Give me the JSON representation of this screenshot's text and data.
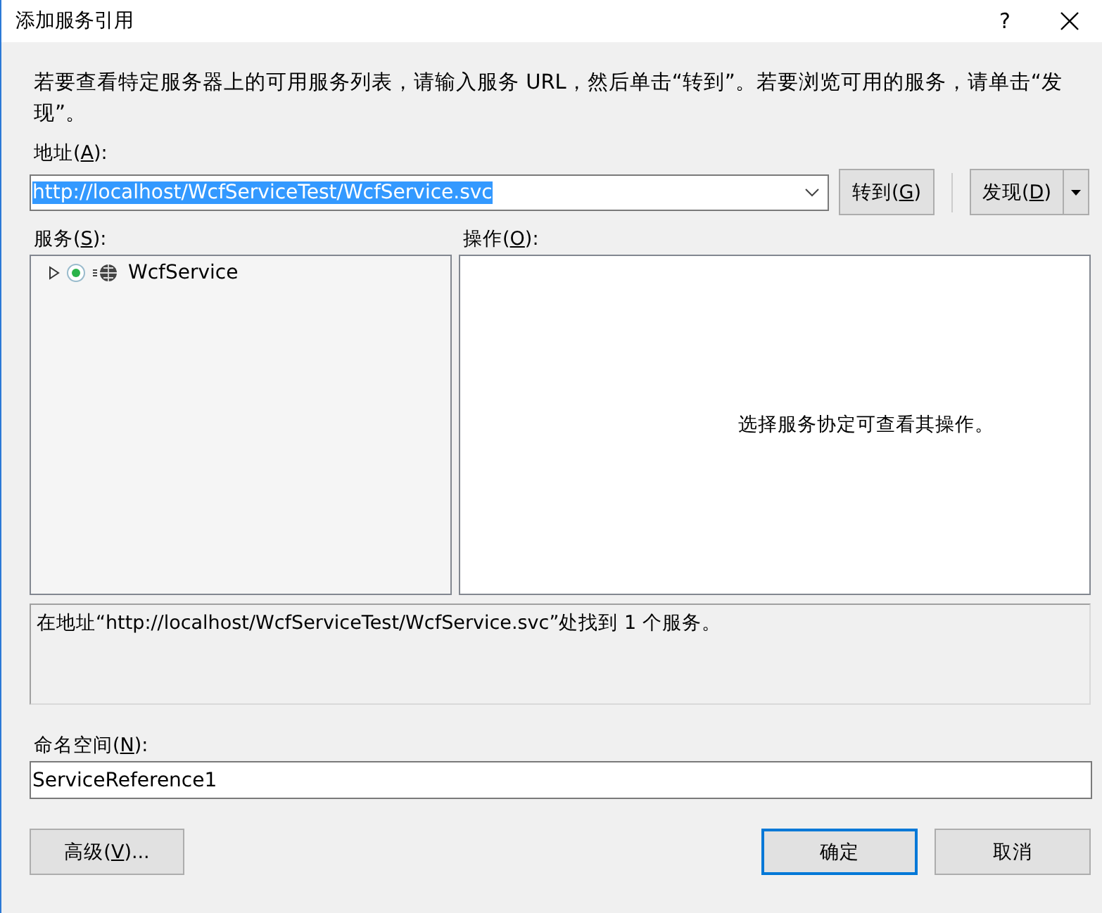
{
  "window": {
    "title": "添加服务引用",
    "help": "?"
  },
  "intro": "若要查看特定服务器上的可用服务列表，请输入服务 URL，然后单击“转到”。若要浏览可用的服务，请单击“发现”。",
  "address": {
    "label": {
      "prefix": "地址(",
      "key": "A",
      "suffix": "):"
    },
    "value": "http://localhost/WcfServiceTest/WcfService.svc",
    "highlighted": true
  },
  "go_button": {
    "prefix": "转到(",
    "key": "G",
    "suffix": ")"
  },
  "discover_button": {
    "prefix": "发现(",
    "key": "D",
    "suffix": ")"
  },
  "services": {
    "label": {
      "prefix": "服务(",
      "key": "S",
      "suffix": "):"
    },
    "items": [
      {
        "name": "WcfService",
        "expanded": false
      }
    ]
  },
  "operations": {
    "label": {
      "prefix": "操作(",
      "key": "O",
      "suffix": "):"
    },
    "empty_message": "选择服务协定可查看其操作。"
  },
  "status": "在地址“http://localhost/WcfServiceTest/WcfService.svc”处找到 1 个服务。",
  "namespace": {
    "label": {
      "prefix": "命名空间(",
      "key": "N",
      "suffix": "):"
    },
    "value": "ServiceReference1"
  },
  "buttons": [
    {
      "kind": "advanced",
      "label": {
        "prefix": "高级(",
        "key": "V",
        "suffix": ")..."
      },
      "default": false
    },
    {
      "kind": "ok",
      "label": {
        "prefix": "确定"
      },
      "default": true
    },
    {
      "kind": "cancel",
      "label": {
        "prefix": "取消"
      },
      "default": false
    }
  ]
}
